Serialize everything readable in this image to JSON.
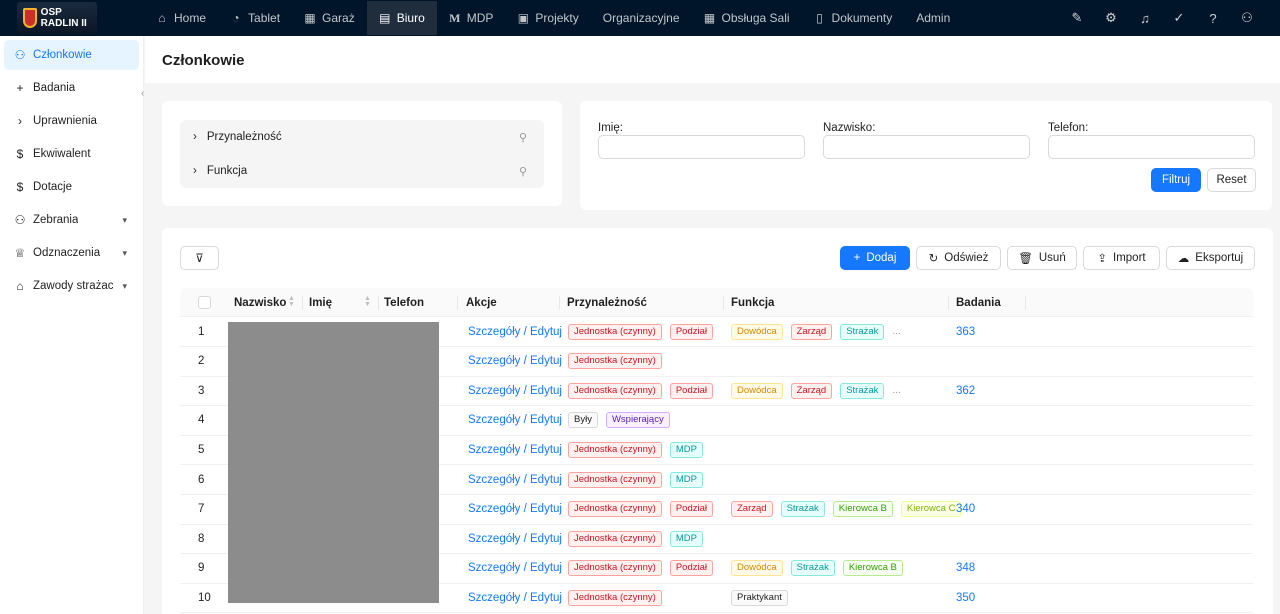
{
  "colors": {
    "topbar": "#001529",
    "primary": "#1677ff",
    "redacted": "#8c8c8c"
  },
  "app": {
    "logo_text": "OSP RADLIN II"
  },
  "nav": [
    {
      "label": "Home",
      "icon": "home-icon",
      "glyph": "⌂"
    },
    {
      "label": "Tablet",
      "icon": "tablet-icon",
      "glyph": "◔"
    },
    {
      "label": "Garaż",
      "icon": "table-icon",
      "glyph": "▦"
    },
    {
      "label": "Biuro",
      "icon": "table-icon",
      "glyph": "▤"
    },
    {
      "label": "MDP",
      "icon": "m-icon",
      "glyph": "M"
    },
    {
      "label": "Projekty",
      "icon": "project-icon",
      "glyph": "▣"
    },
    {
      "label": "Organizacyjne",
      "icon": "",
      "glyph": ""
    },
    {
      "label": "Obsługa Sali",
      "icon": "table-icon",
      "glyph": "▦"
    },
    {
      "label": "Dokumenty",
      "icon": "document-icon",
      "glyph": "▯"
    },
    {
      "label": "Admin",
      "icon": "",
      "glyph": ""
    }
  ],
  "sidebar": {
    "items": [
      {
        "label": "Członkowie",
        "icon": "user-icon",
        "glyph": "⚇",
        "expandable": false
      },
      {
        "label": "Badania",
        "icon": "plus-icon",
        "glyph": "+",
        "expandable": false
      },
      {
        "label": "Uprawnienia",
        "icon": "chevron-right-icon",
        "glyph": "›",
        "expandable": false
      },
      {
        "label": "Ekwiwalent",
        "icon": "dollar-icon",
        "glyph": "$",
        "expandable": false
      },
      {
        "label": "Dotacje",
        "icon": "dollar-icon",
        "glyph": "$",
        "expandable": false
      },
      {
        "label": "Zebrania",
        "icon": "team-icon",
        "glyph": "⚇",
        "expandable": true
      },
      {
        "label": "Odznaczenia",
        "icon": "trophy-icon",
        "glyph": "♕",
        "expandable": true
      },
      {
        "label": "Zawody strażackie",
        "icon": "bank-icon",
        "glyph": "⌂",
        "expandable": true
      }
    ]
  },
  "page": {
    "title": "Członkowie"
  },
  "tree_filter": {
    "items": [
      "Przynależność",
      "Funkcja"
    ]
  },
  "form": {
    "imie_label": "Imię",
    "nazwisko_label": "Nazwisko",
    "telefon_label": "Telefon",
    "imie_value": "",
    "nazwisko_value": "",
    "telefon_value": "",
    "filter_label": "Filtruj",
    "reset_label": "Reset"
  },
  "toolbar": {
    "add_label": "Dodaj",
    "refresh_label": "Odśwież",
    "delete_label": "Usuń",
    "import_label": "Import",
    "export_label": "Eksportuj"
  },
  "table": {
    "columns": {
      "nazwisko": "Nazwisko",
      "imie": "Imię",
      "telefon": "Telefon",
      "akcje": "Akcje",
      "przynaleznosc": "Przynależność",
      "funkcja": "Funkcja",
      "badania": "Badania"
    },
    "action_label": "Szczegóły / Edytuj",
    "rows": [
      {
        "num": "1",
        "przynaleznosc": [
          "Jednostka (czynny)",
          "Podział"
        ],
        "funkcja": [
          "Dowódca",
          "Zarząd",
          "Strażak"
        ],
        "more": "...",
        "badania": "363"
      },
      {
        "num": "2",
        "przynaleznosc": [
          "Jednostka (czynny)"
        ],
        "funkcja": [],
        "more": "",
        "badania": ""
      },
      {
        "num": "3",
        "przynaleznosc": [
          "Jednostka (czynny)",
          "Podział"
        ],
        "funkcja": [
          "Dowódca",
          "Zarząd",
          "Strażak"
        ],
        "more": "...",
        "badania": "362"
      },
      {
        "num": "4",
        "przynaleznosc": [
          "Były",
          "Wspierający"
        ],
        "funkcja": [],
        "more": "",
        "badania": ""
      },
      {
        "num": "5",
        "przynaleznosc": [
          "Jednostka (czynny)",
          "MDP"
        ],
        "funkcja": [],
        "more": "",
        "badania": ""
      },
      {
        "num": "6",
        "przynaleznosc": [
          "Jednostka (czynny)",
          "MDP"
        ],
        "funkcja": [],
        "more": "",
        "badania": ""
      },
      {
        "num": "7",
        "przynaleznosc": [
          "Jednostka (czynny)",
          "Podział"
        ],
        "funkcja": [
          "Zarząd",
          "Strażak",
          "Kierowca B",
          "Kierowca C"
        ],
        "more": "",
        "badania": "340"
      },
      {
        "num": "8",
        "przynaleznosc": [
          "Jednostka (czynny)",
          "MDP"
        ],
        "funkcja": [],
        "more": "",
        "badania": ""
      },
      {
        "num": "9",
        "przynaleznosc": [
          "Jednostka (czynny)",
          "Podział"
        ],
        "funkcja": [
          "Dowódca",
          "Strażak",
          "Kierowca B"
        ],
        "more": "",
        "badania": "348"
      },
      {
        "num": "10",
        "przynaleznosc": [
          "Jednostka (czynny)"
        ],
        "funkcja": [
          "Praktykant"
        ],
        "more": "",
        "badania": "350"
      }
    ]
  },
  "tag_colors": {
    "Jednostka (czynny)": {
      "fg": "#cf1322",
      "bg": "#fff1f0",
      "border": "#ffa39e"
    },
    "Podział": {
      "fg": "#cf1322",
      "bg": "#fff1f0",
      "border": "#ffa39e"
    },
    "Zarząd": {
      "fg": "#cf1322",
      "bg": "#fff1f0",
      "border": "#ffa39e"
    },
    "Dowódca": {
      "fg": "#d48806",
      "bg": "#fffbe6",
      "border": "#ffe58f"
    },
    "Strażak": {
      "fg": "#08979c",
      "bg": "#e6fffb",
      "border": "#87e8de"
    },
    "MDP": {
      "fg": "#08979c",
      "bg": "#e6fffb",
      "border": "#87e8de"
    },
    "Kierowca B": {
      "fg": "#389e0d",
      "bg": "#f6ffed",
      "border": "#b7eb8f"
    },
    "Kierowca C": {
      "fg": "#7cb305",
      "bg": "#fcffe6",
      "border": "#eaff8f"
    },
    "Wspierający": {
      "fg": "#531dab",
      "bg": "#f9f0ff",
      "border": "#d3adf7"
    },
    "Były": {
      "fg": "rgba(0,0,0,0.88)",
      "bg": "#fafafa",
      "border": "#d9d9d9"
    },
    "Praktykant": {
      "fg": "rgba(0,0,0,0.88)",
      "bg": "#fafafa",
      "border": "#d9d9d9"
    }
  }
}
